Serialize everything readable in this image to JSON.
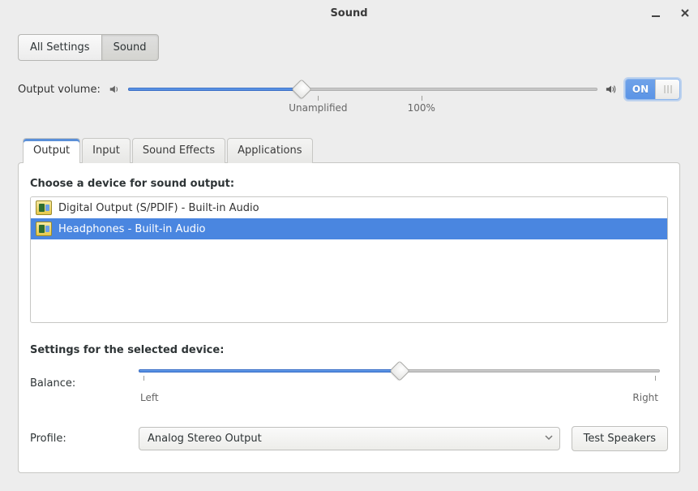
{
  "window": {
    "title": "Sound"
  },
  "breadcrumb": {
    "all_settings": "All Settings",
    "sound": "Sound"
  },
  "volume": {
    "label": "Output volume:",
    "tick_unamp": "Unamplified",
    "tick_100": "100%",
    "switch_on": "ON",
    "value_percent": 37
  },
  "tabs": [
    "Output",
    "Input",
    "Sound Effects",
    "Applications"
  ],
  "output": {
    "choose_label": "Choose a device for sound output:",
    "devices": [
      "Digital Output (S/PDIF) - Built-in Audio",
      "Headphones - Built-in Audio"
    ],
    "selected_index": 1,
    "settings_label": "Settings for the selected device:",
    "balance_label": "Balance:",
    "balance_value_percent": 50,
    "balance_left": "Left",
    "balance_right": "Right",
    "profile_label": "Profile:",
    "profile_value": "Analog Stereo Output",
    "test_speakers": "Test Speakers"
  }
}
